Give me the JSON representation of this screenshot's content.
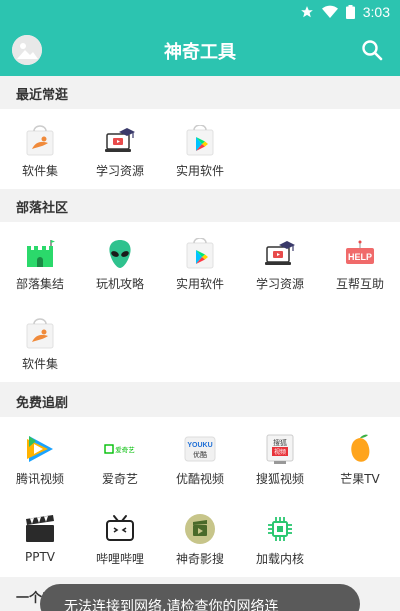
{
  "status": {
    "time": "3:03"
  },
  "appbar": {
    "title": "神奇工具"
  },
  "sections": [
    {
      "title": "最近常逛",
      "items": [
        "软件集",
        "学习资源",
        "实用软件"
      ]
    },
    {
      "title": "部落社区",
      "items": [
        "部落集结",
        "玩机攻略",
        "实用软件",
        "学习资源",
        "互帮互助",
        "软件集"
      ]
    },
    {
      "title": "免费追剧",
      "items": [
        "腾讯视频",
        "爱奇艺",
        "优酷视频",
        "搜狐视频",
        "芒果TV",
        "PPTV",
        "哔哩哔哩",
        "神奇影搜",
        "加载内核"
      ]
    },
    {
      "title": "一个工具"
    }
  ],
  "icons": {
    "youku_text": "YOUKU",
    "youku_sub": "优酷",
    "sohu_text": "搜狐",
    "sohu_sub": "视频",
    "iqiyi_text": "爱奇艺",
    "help_text": "HELP"
  },
  "toast": {
    "message": "无法连接到网络,请检查你的网络连"
  },
  "colors": {
    "primary": "#2cc4b0",
    "toast": "#5a5a5a"
  }
}
